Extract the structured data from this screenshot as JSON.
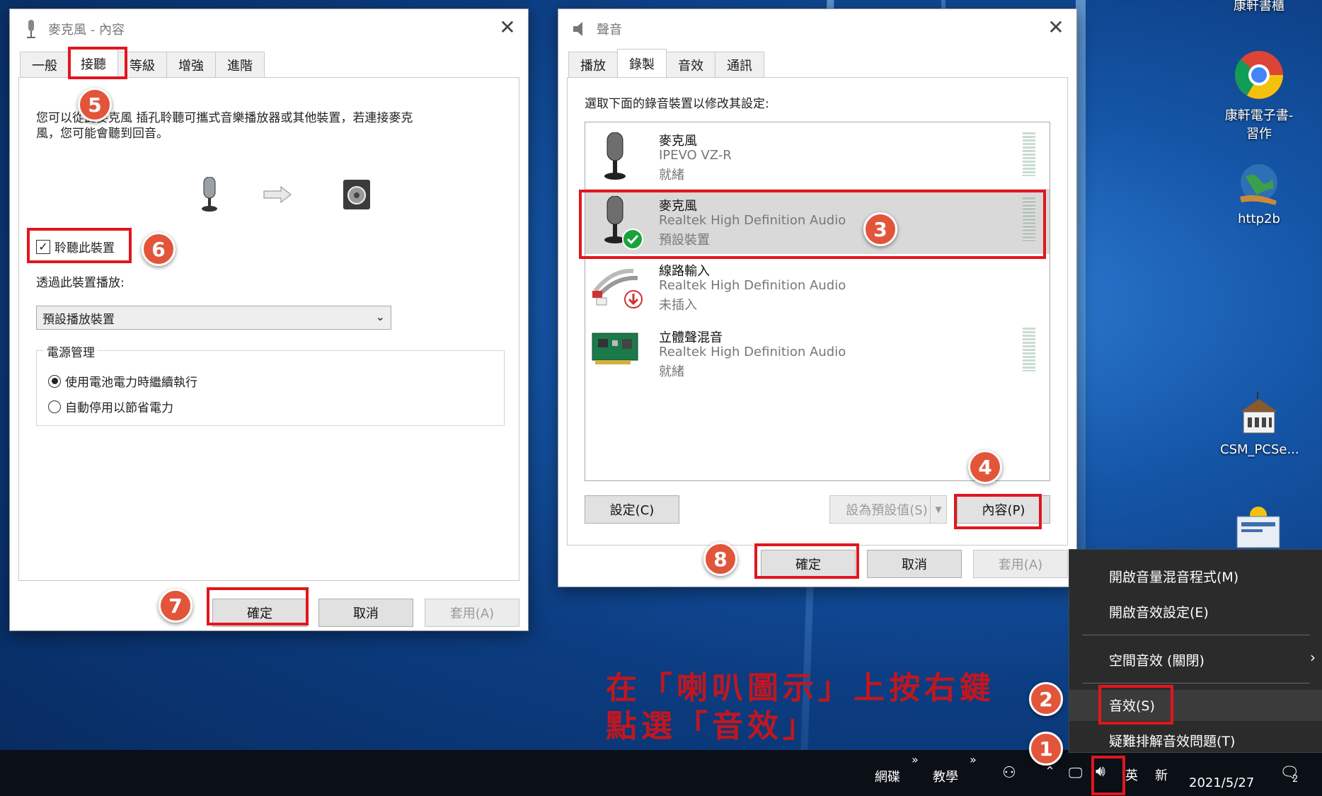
{
  "colors": {
    "highlight": "#e1161f",
    "callout": "#e2553a",
    "annotation_text": "#c0171f",
    "taskbar": "#0b0f16",
    "context_menu": "#2b2b2b"
  },
  "mic_props": {
    "title": "麥克風 - 內容",
    "tabs": [
      "一般",
      "接聽",
      "等級",
      "增強",
      "進階"
    ],
    "active_tab": "接聽",
    "desc_line1": "您可以從此麥克風 插孔聆聽可攜式音樂播放器或其他裝置，若連接麥克",
    "desc_line2": "風，您可能會聽到回音。",
    "listen_checkbox": "聆聽此裝置",
    "listen_checked": true,
    "playback_label": "透過此裝置播放:",
    "playback_select": "預設播放裝置",
    "power_group": "電源管理",
    "radio1": "使用電池電力時繼續執行",
    "radio2": "自動停用以節省電力",
    "radio_selected": 1,
    "ok": "確定",
    "cancel": "取消",
    "apply": "套用(A)"
  },
  "sound": {
    "title": "聲音",
    "tabs": [
      "播放",
      "錄製",
      "音效",
      "通訊"
    ],
    "active_tab": "錄製",
    "instruction": "選取下面的錄音裝置以修改其設定:",
    "devices": [
      {
        "name": "麥克風",
        "driver": "IPEVO VZ-R",
        "status": "就緒",
        "icon": "microphone-icon"
      },
      {
        "name": "麥克風",
        "driver": "Realtek High Definition Audio",
        "status": "預設裝置",
        "icon": "microphone-default-icon"
      },
      {
        "name": "線路輸入",
        "driver": "Realtek High Definition Audio",
        "status": "未插入",
        "icon": "line-in-icon"
      },
      {
        "name": "立體聲混音",
        "driver": "Realtek High Definition Audio",
        "status": "就緒",
        "icon": "sound-card-icon"
      }
    ],
    "selected_device": 1,
    "configure": "設定(C)",
    "set_default": "設為預設值(S)",
    "properties": "內容(P)",
    "ok": "確定",
    "cancel": "取消",
    "apply": "套用(A)"
  },
  "context_menu": {
    "items": [
      "開啟音量混音程式(M)",
      "開啟音效設定(E)",
      "空間音效 (關閉)",
      "音效(S)",
      "疑難排解音效問題(T)"
    ]
  },
  "annotation": {
    "line1": "在「喇叭圖示」上按右鍵",
    "line2": "點選「音效」"
  },
  "callouts": [
    "1",
    "2",
    "3",
    "4",
    "5",
    "6",
    "7",
    "8"
  ],
  "desktop_icons": [
    {
      "label": "康軒書櫃",
      "icon": "bookshelf-icon"
    },
    {
      "label": "康軒電子書-習作",
      "icon": "chrome-icon"
    },
    {
      "label": "http2b",
      "icon": "globe-icon"
    },
    {
      "label": "CSM_PCSe...",
      "icon": "school-building-icon"
    }
  ],
  "taskbar": {
    "toolbar1": "網碟",
    "toolbar2": "教學",
    "ime1": "英",
    "ime2": "新",
    "time": "",
    "date": "2021/5/27",
    "notification_count": "2"
  }
}
